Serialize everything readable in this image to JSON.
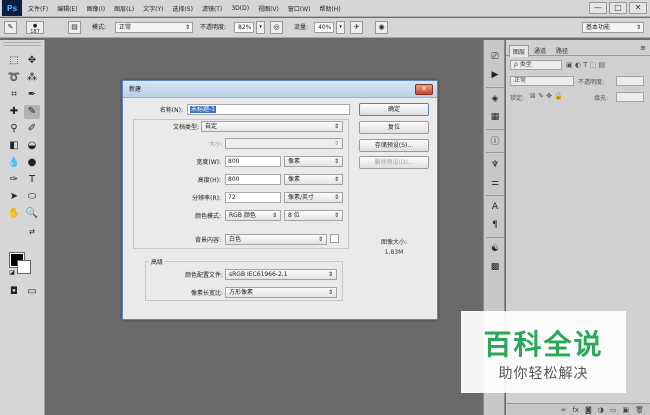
{
  "app": {
    "logo": "Ps",
    "menus": [
      "文件(F)",
      "编辑(E)",
      "图像(I)",
      "图层(L)",
      "文字(Y)",
      "选择(S)",
      "滤镜(T)",
      "3D(D)",
      "视图(V)",
      "窗口(W)",
      "帮助(H)"
    ],
    "window_controls": [
      "—",
      "□",
      "✕"
    ]
  },
  "options_bar": {
    "brush_size": "187",
    "mode_label": "模式:",
    "mode_value": "正常",
    "opacity_label": "不透明度:",
    "opacity_value": "82%",
    "flow_label": "流量:",
    "flow_value": "40%",
    "workspace": "基本功能"
  },
  "layers_panel": {
    "tabs": [
      "图层",
      "通道",
      "路径"
    ],
    "kind_filter": "ρ 类型",
    "blend_mode": "正常",
    "opacity_label": "不透明度:",
    "lock_label": "锁定:",
    "fill_label": "填充:"
  },
  "dialog": {
    "title": "新建",
    "close": "✕",
    "fields": {
      "name_label": "名称(N):",
      "name_value": "未标题-1",
      "preset_label": "文档类型:",
      "preset_value": "自定",
      "size_label": "大小:",
      "size_value": "",
      "width_label": "宽度(W):",
      "width_value": "800",
      "width_unit": "像素",
      "height_label": "高度(H):",
      "height_value": "800",
      "height_unit": "像素",
      "resolution_label": "分辨率(R):",
      "resolution_value": "72",
      "resolution_unit": "像素/英寸",
      "color_mode_label": "颜色模式:",
      "color_mode_value": "RGB 颜色",
      "bit_depth": "8 位",
      "background_label": "背景内容:",
      "background_value": "白色"
    },
    "advanced": {
      "title": "高级",
      "profile_label": "颜色配置文件:",
      "profile_value": "sRGB IEC61966-2.1",
      "aspect_label": "像素长宽比:",
      "aspect_value": "方形像素"
    },
    "buttons": {
      "ok": "确定",
      "reset": "复位",
      "save_preset": "存储预设(S)...",
      "delete_preset": "删除预设(D)..."
    },
    "image_size_label": "图像大小:",
    "image_size_value": "1.83M"
  },
  "watermark": {
    "title": "百科全说",
    "subtitle": "助你轻松解决"
  }
}
